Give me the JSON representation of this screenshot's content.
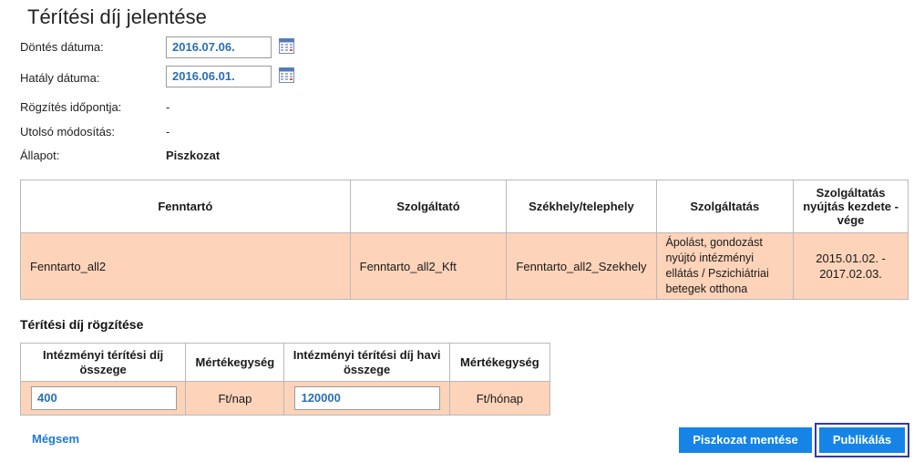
{
  "page": {
    "title": "Térítési díj jelentése"
  },
  "form": {
    "decision_date": {
      "label": "Döntés dátuma:",
      "value": "2016.07.06."
    },
    "effect_date": {
      "label": "Hatály dátuma:",
      "value": "2016.06.01."
    },
    "recorded_at": {
      "label": "Rögzítés időpontja:",
      "value": "-"
    },
    "last_modified": {
      "label": "Utolsó módosítás:",
      "value": "-"
    },
    "status": {
      "label": "Állapot:",
      "value": "Piszkozat"
    }
  },
  "info_table": {
    "headers": [
      "Fenntartó",
      "Szolgáltató",
      "Székhely/telephely",
      "Szolgáltatás",
      "Szolgáltatás nyújtás kezdete - vége"
    ],
    "row": [
      "Fenntarto_all2",
      "Fenntarto_all2_Kft",
      "Fenntarto_all2_Szekhely",
      "Ápolást, gondozást nyújtó intézményi ellátás / Pszichiátriai betegek otthona",
      "2015.01.02. - 2017.02.03."
    ]
  },
  "fee_section": {
    "title": "Térítési díj rögzítése",
    "headers": [
      "Intézményi térítési díj összege",
      "Mértékegység",
      "Intézményi térítési díj havi összege",
      "Mértékegység"
    ],
    "daily_amount": "400",
    "daily_unit": "Ft/nap",
    "monthly_amount": "120000",
    "monthly_unit": "Ft/hónap"
  },
  "actions": {
    "cancel": "Mégsem",
    "save_draft": "Piszkozat mentése",
    "publish": "Publikálás"
  },
  "colors": {
    "accent": "#1584e6",
    "row_bg": "#fdd3b9",
    "focus_border": "#3339a8"
  }
}
